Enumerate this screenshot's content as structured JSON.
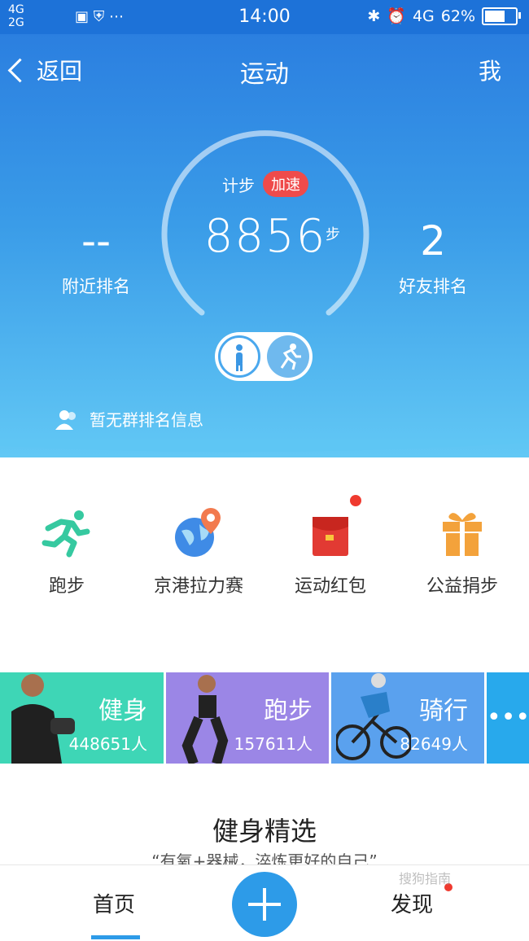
{
  "status_bar": {
    "network_top": "4G",
    "network_bottom": "2G",
    "time": "14:00",
    "right_network": "4G",
    "battery_percent": "62%",
    "battery_level": 0.62
  },
  "nav": {
    "back_label": "返回",
    "title": "运动",
    "me_label": "我"
  },
  "pedometer": {
    "label": "计步",
    "badge": "加速",
    "steps": "8856",
    "unit": "步",
    "nearby_value": "--",
    "nearby_label": "附近排名",
    "friends_value": "2",
    "friends_label": "好友排名",
    "group_info": "暂无群排名信息"
  },
  "features": [
    {
      "label": "跑步",
      "icon": "running-icon"
    },
    {
      "label": "京港拉力赛",
      "icon": "globe-pin-icon"
    },
    {
      "label": "运动红包",
      "icon": "red-envelope-icon"
    },
    {
      "label": "公益捐步",
      "icon": "gift-icon"
    }
  ],
  "cards": [
    {
      "title": "健身",
      "count": "448651人",
      "color": "#3ed6b6"
    },
    {
      "title": "跑步",
      "count": "157611人",
      "color": "#9b86e6"
    },
    {
      "title": "骑行",
      "count": "82649人",
      "color": "#5aa1ee"
    }
  ],
  "more_label": "•••",
  "section": {
    "title": "健身精选",
    "subtitle": "“有氧+器械，淬炼更好的自己”"
  },
  "tabbar": {
    "home": "首页",
    "discover": "发现"
  },
  "watermark": "搜狗指南"
}
